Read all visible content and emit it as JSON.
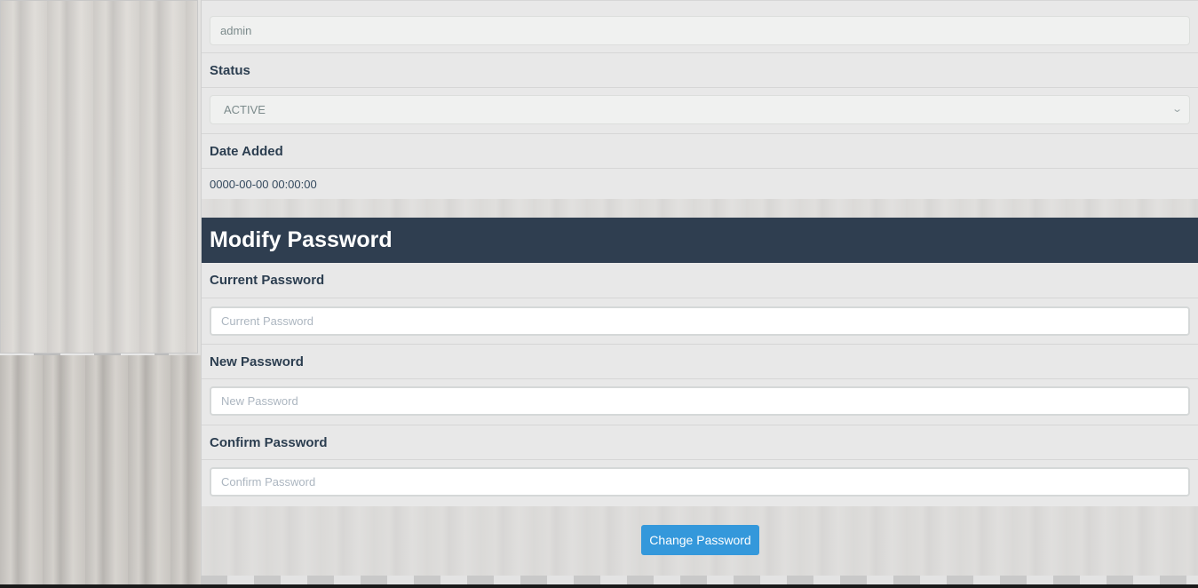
{
  "profile": {
    "username_value": "admin",
    "status_label": "Status",
    "status_selected": "ACTIVE",
    "date_added_label": "Date Added",
    "date_added_value": "0000-00-00 00:00:00"
  },
  "password_section": {
    "title": "Modify Password",
    "current_label": "Current Password",
    "current_placeholder": "Current Password",
    "new_label": "New Password",
    "new_placeholder": "New Password",
    "confirm_label": "Confirm Password",
    "confirm_placeholder": "Confirm Password",
    "submit_label": "Change Password"
  },
  "icons": {
    "status_dropdown": "chevron-down-icon"
  },
  "colors": {
    "header_bg": "#2f3e50",
    "label_text": "#2c3e50",
    "button_bg": "#3498db"
  }
}
